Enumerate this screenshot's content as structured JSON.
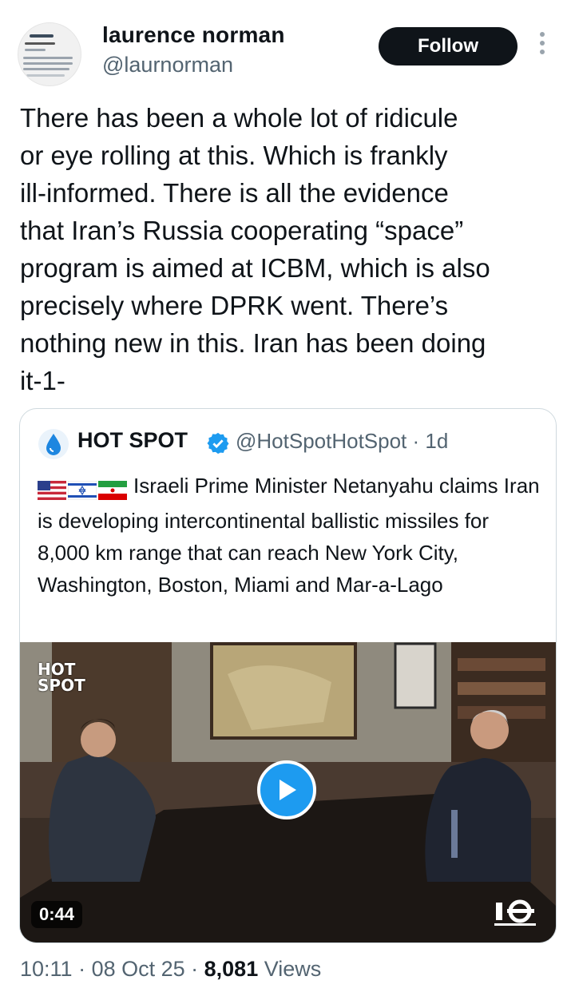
{
  "author": {
    "name": "laurence norman",
    "handle": "@laurnorman",
    "follow_label": "Follow"
  },
  "tweet": {
    "text": "There has been a whole lot of ridicule\nor eye rolling at this. Which is frankly\nill-informed. There is all the evidence\nthat Iran’s Russia cooperating “space”\nprogram is aimed at ICBM, which is also\nprecisely where DPRK went. There’s\nnothing new in this. Iran has been doing\nit-1-"
  },
  "quote": {
    "name": "HOT SPOT",
    "handle_time": "@HotSpotHotSpot · 1d",
    "text": "Israeli Prime Minister Netanyahu claims Iran is developing intercontinental ballistic missiles for 8,000 km range that can reach New York City, Washington, Boston, Miami and Mar-a-Lago",
    "video": {
      "duration": "0:44",
      "watermark_line1": "HOT",
      "watermark_line2": "SPOT"
    }
  },
  "meta": {
    "time": "10:11",
    "date": "08 Oct 25",
    "views_count": "8,081",
    "views_label": "Views"
  },
  "colors": {
    "accent": "#1d9bf0",
    "text": "#0f1419",
    "muted": "#536471",
    "border": "#cfd9de"
  },
  "icons": [
    "more-vertical-icon",
    "verified-icon",
    "play-icon",
    "water-drop-icon",
    "us-flag-icon",
    "israel-flag-icon",
    "iran-flag-icon"
  ]
}
